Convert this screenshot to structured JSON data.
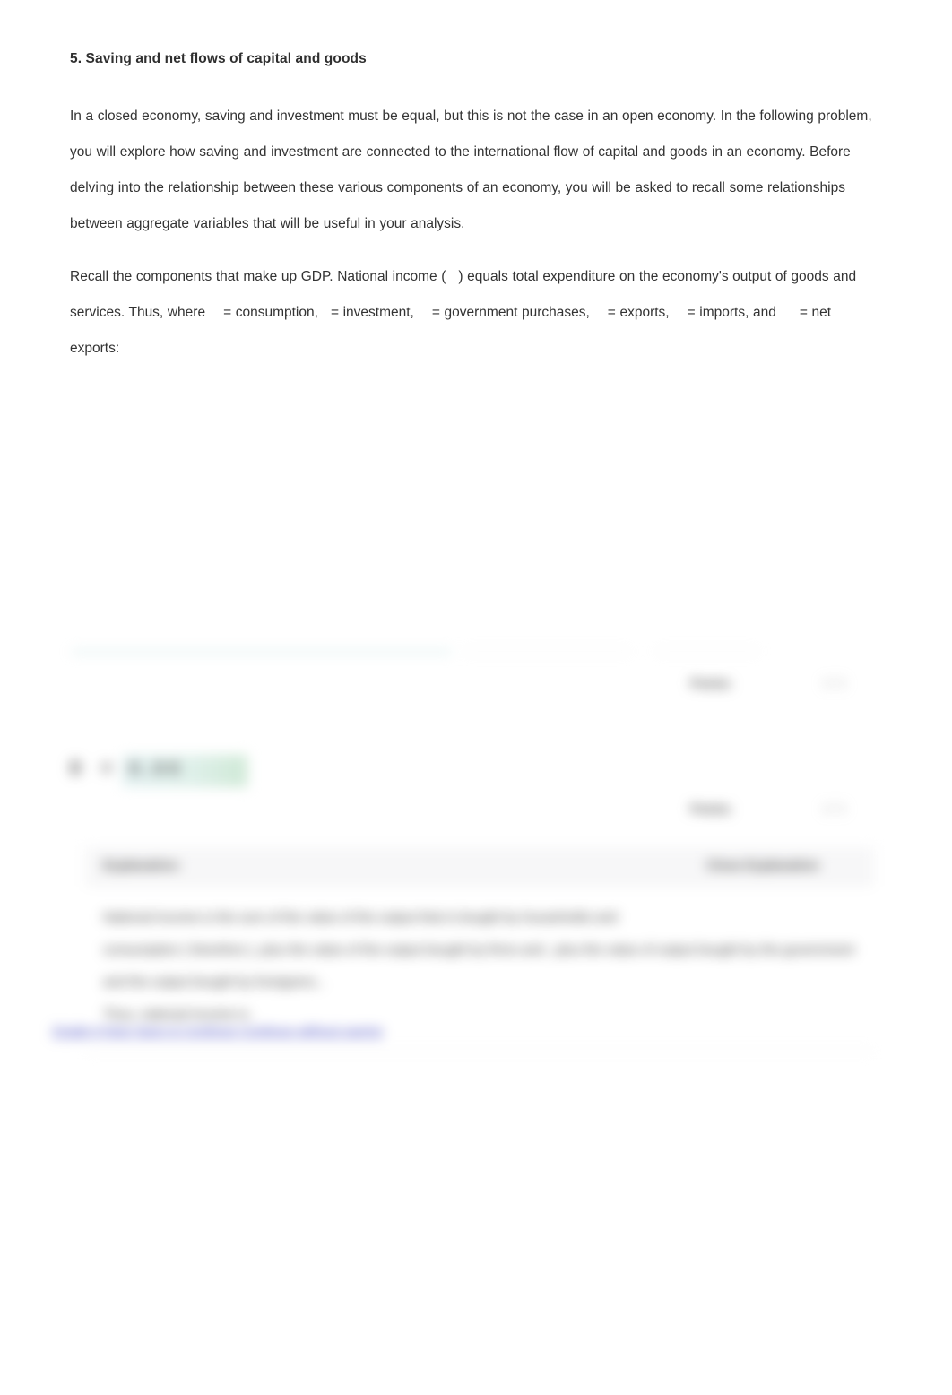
{
  "problem": {
    "title": "5. Saving and net flows of capital and goods",
    "paragraph_1": "In a closed economy, saving and investment must be equal, but this is not the case in an open economy. In the following problem, you will explore how saving and investment are connected to the international flow of capital and goods in an economy. Before delving into the relationship between these various components of an economy, you will be asked to recall some relationships between aggregate variables that will be useful in your analysis.",
    "paragraph_2_parts": {
      "a": "Recall the components that make up GDP. National income (",
      "b": ") equals total expenditure on the economy's output of goods and services. Thus, where",
      "c": "= consumption,",
      "d": "= investment,",
      "e": "= government purchases,",
      "f": "= exports,",
      "g": "= imports, and",
      "h": "= net exports:"
    }
  },
  "grading": {
    "points_label_1": "Points:",
    "points_value_1": "1 / 1",
    "points_label_2": "Points:",
    "points_value_2": "1 / 1",
    "score_prefix": "0 =",
    "score_chip": "0.00"
  },
  "table": {
    "header_left": "Explanation:",
    "header_right": "Close Explanation",
    "body_line_1": "National income is the sum of the value of the output that is bought by households and",
    "body_line_2": "consumption ( therefore            ), plus the value of the output bought by firms and            , plus the value of output bought by the government and the output bought by foreigners,            .",
    "body_line_3": "Thus, national income is            ."
  },
  "footer": {
    "link_text": "Grade It Now    Save & Continue    Continue without saving"
  },
  "colors": {
    "text": "#333333",
    "title": "#2f2f2f",
    "teal_rule": "#bfe0e0",
    "link": "#4a4fc4",
    "table_header_bg": "#f7f7f8",
    "chip_green": "#cfe9d6"
  }
}
